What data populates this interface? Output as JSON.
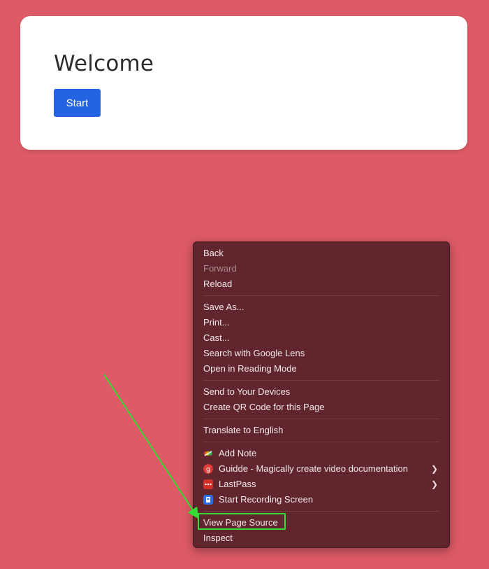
{
  "card": {
    "title": "Welcome",
    "start_label": "Start"
  },
  "context_menu": {
    "groups": [
      [
        {
          "label": "Back",
          "enabled": true
        },
        {
          "label": "Forward",
          "enabled": false
        },
        {
          "label": "Reload",
          "enabled": true
        }
      ],
      [
        {
          "label": "Save As...",
          "enabled": true
        },
        {
          "label": "Print...",
          "enabled": true
        },
        {
          "label": "Cast...",
          "enabled": true
        },
        {
          "label": "Search with Google Lens",
          "enabled": true
        },
        {
          "label": "Open in Reading Mode",
          "enabled": true
        }
      ],
      [
        {
          "label": "Send to Your Devices",
          "enabled": true
        },
        {
          "label": "Create QR Code for this Page",
          "enabled": true
        }
      ],
      [
        {
          "label": "Translate to English",
          "enabled": true
        }
      ],
      [
        {
          "label": "Add Note",
          "icon": "add-note-icon",
          "submenu": false
        },
        {
          "label": "Guidde - Magically create video documentation",
          "icon": "guidde-icon",
          "submenu": true
        },
        {
          "label": "LastPass",
          "icon": "lastpass-icon",
          "submenu": true
        },
        {
          "label": "Start Recording Screen",
          "icon": "screen-recorder-icon",
          "submenu": false
        }
      ],
      [
        {
          "label": "View Page Source",
          "enabled": true,
          "highlighted": true
        },
        {
          "label": "Inspect",
          "enabled": true
        }
      ]
    ]
  },
  "colors": {
    "page_background": "#dd5a66",
    "menu_background": "#61262d",
    "primary_button": "#2463e3",
    "highlight_outline": "#33dd33"
  }
}
